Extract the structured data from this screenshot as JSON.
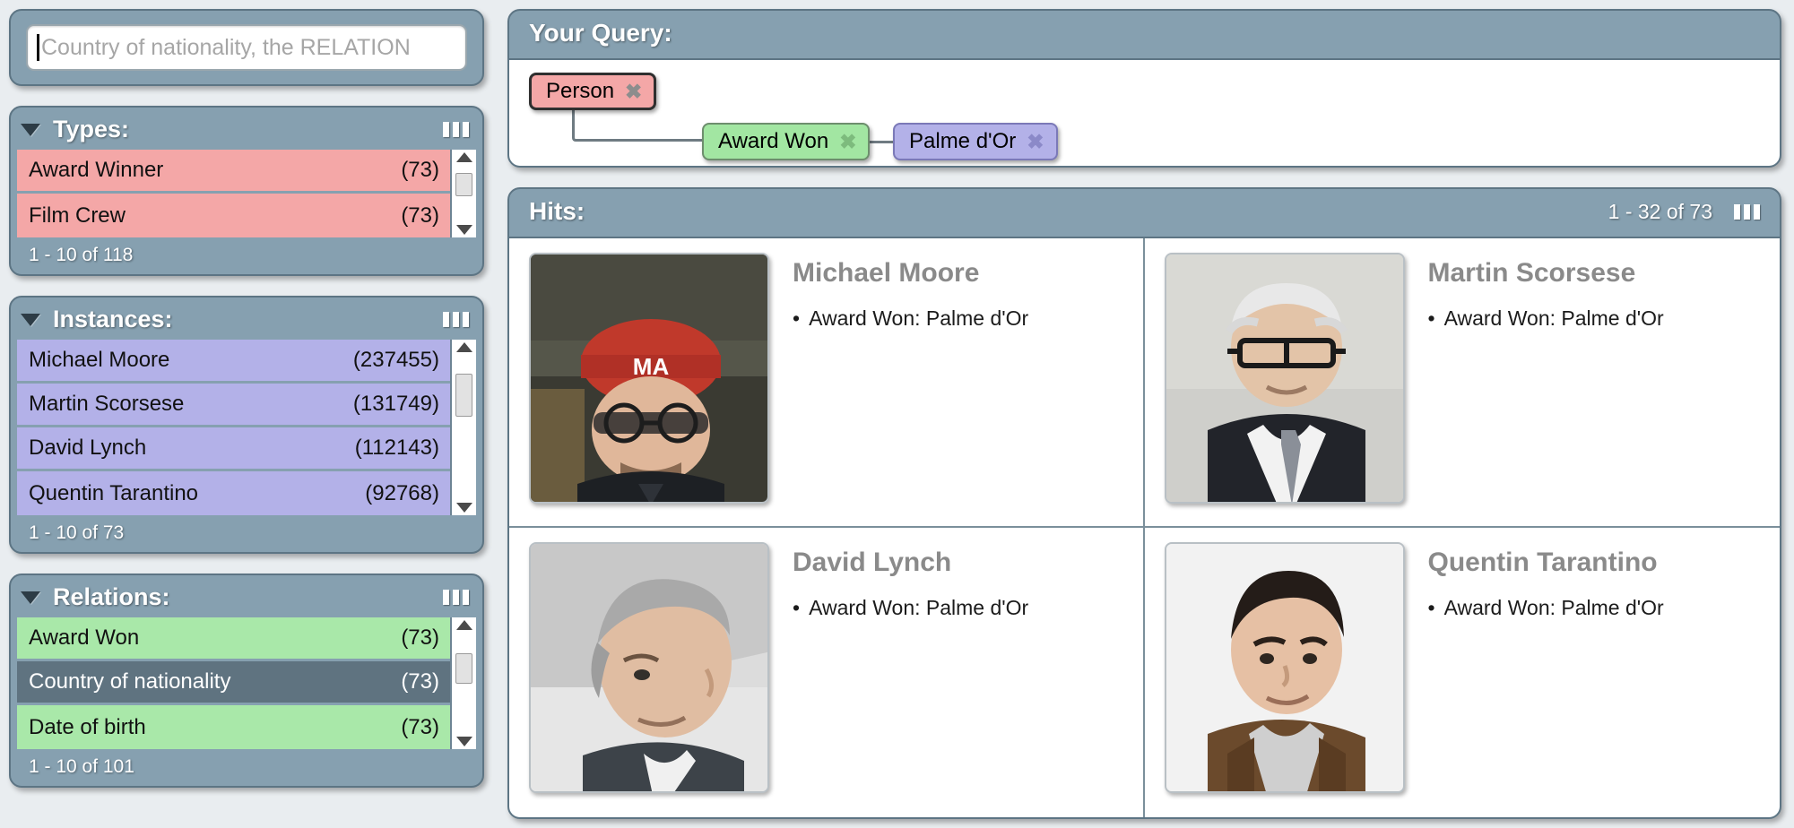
{
  "search": {
    "value": "",
    "placeholder": "Country of nationality, the RELATION"
  },
  "facets": [
    {
      "id": "types",
      "title": "Types:",
      "kind": "type",
      "pager": "1 - 10 of 118",
      "items": [
        {
          "label": "Award Winner",
          "count": "(73)",
          "selected": false
        },
        {
          "label": "Film Crew",
          "count": "(73)",
          "selected": false
        }
      ]
    },
    {
      "id": "instances",
      "title": "Instances:",
      "kind": "instance",
      "pager": "1 - 10 of 73",
      "items": [
        {
          "label": "Michael Moore",
          "count": "(237455)",
          "selected": false
        },
        {
          "label": "Martin Scorsese",
          "count": "(131749)",
          "selected": false
        },
        {
          "label": "David Lynch",
          "count": "(112143)",
          "selected": false
        },
        {
          "label": "Quentin Tarantino",
          "count": "(92768)",
          "selected": false
        }
      ]
    },
    {
      "id": "relations",
      "title": "Relations:",
      "kind": "relation",
      "pager": "1 - 10 of 101",
      "items": [
        {
          "label": "Award Won",
          "count": "(73)",
          "selected": false
        },
        {
          "label": "Country of nationality",
          "count": "(73)",
          "selected": true
        },
        {
          "label": "Date of birth",
          "count": "(73)",
          "selected": false
        }
      ]
    }
  ],
  "query": {
    "title": "Your Query:",
    "nodes": [
      {
        "label": "Person",
        "close": "✖"
      },
      {
        "label": "Award Won",
        "close": "✖"
      },
      {
        "label": "Palme d'Or",
        "close": "✖"
      }
    ]
  },
  "hits": {
    "title": "Hits:",
    "count": "1 - 32 of 73",
    "items": [
      {
        "name": "Michael Moore",
        "fact": "Award Won: Palme d'Or"
      },
      {
        "name": "Martin Scorsese",
        "fact": "Award Won: Palme d'Or"
      },
      {
        "name": "David Lynch",
        "fact": "Award Won: Palme d'Or"
      },
      {
        "name": "Quentin Tarantino",
        "fact": "Award Won: Palme d'Or"
      }
    ]
  },
  "colors": {
    "panel": "#86a0b0",
    "type": "#f4a7a7",
    "instance": "#b3b1e8",
    "relation": "#a9e8a9",
    "selected": "#5f7380"
  }
}
